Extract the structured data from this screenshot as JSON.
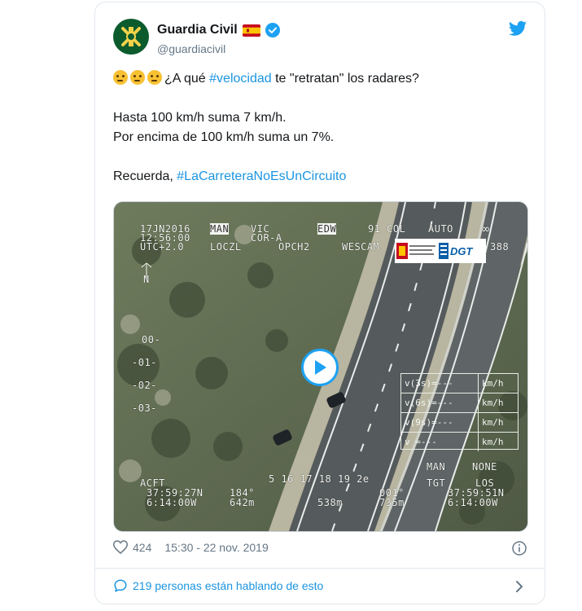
{
  "account": {
    "name": "Guardia Civil",
    "handle": "@guardiacivil"
  },
  "tweet": {
    "line1_prefix": "¿A qué ",
    "line1_hashtag": "#velocidad",
    "line1_suffix": " te \"retratan\" los radares?",
    "line2": "Hasta 100 km/h suma 7 km/h.",
    "line3": "Por encima de 100 km/h suma un 7%.",
    "line4_prefix": "Recuerda, ",
    "line4_hashtag": "#LaCarreteraNoEsUnCircuito"
  },
  "video_overlay": {
    "date": "17JN2016",
    "mode": "MAN",
    "vic": "VIC",
    "time": "12:56:00",
    "cor": "COR-A",
    "utc": "UTC+2.0",
    "loczl": "LOCZL",
    "opch": "OPCH2",
    "wescam": "WESCAM",
    "edw": "EDW",
    "col": "91 COL",
    "auto": "AUTO",
    "infinity": "∞",
    "num388": "388",
    "north": "N",
    "scale": [
      "00-",
      "-01-",
      "-02-",
      "-03-"
    ],
    "ruler": "5 16 17 18 19 2e",
    "acft": "ACFT",
    "acft_lat": "37:59:27N",
    "acft_lon": "6:14:00W",
    "heading": "184°",
    "alt1": "642m",
    "range": "538m",
    "tgt_mode": "MAN",
    "none": "NONE",
    "tgt": "TGT",
    "los": "LOS",
    "tgt_lat": "37:59:51N",
    "tgt_lon": "6:14:00W",
    "angle": "001°",
    "alt2": "735m",
    "speed_rows": [
      {
        "label": "v(3s)=---",
        "unit": "km/h"
      },
      {
        "label": "v(6s)=---",
        "unit": "km/h"
      },
      {
        "label": "v(9s)=---",
        "unit": "km/h"
      },
      {
        "label": "v =---",
        "unit": "km/h"
      }
    ],
    "logo_ministry": "MINISTERIO DEL INTERIOR",
    "logo_dgt": "DGT"
  },
  "meta": {
    "likes": "424",
    "timestamp": "15:30 - 22 nov. 2019"
  },
  "footer": {
    "conversation": "219 personas están hablando de esto"
  },
  "colors": {
    "link": "#1b95e0",
    "verified": "#1da1f2",
    "text_secondary": "#657786"
  }
}
